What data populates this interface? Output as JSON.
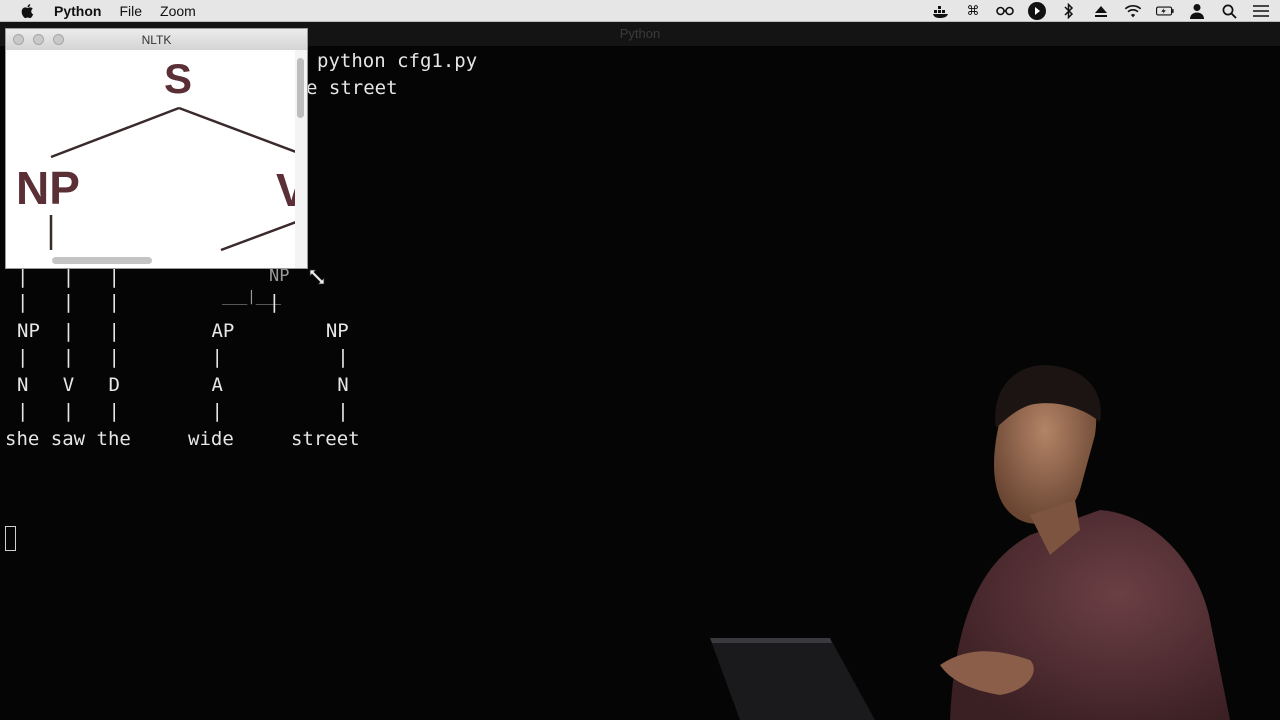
{
  "menubar": {
    "app_name": "Python",
    "menus": [
      "File",
      "Zoom"
    ],
    "status_icons": [
      "docker-icon",
      "command-icon",
      "glasses-icon",
      "play-icon",
      "bluetooth-icon",
      "eject-icon",
      "wifi-icon",
      "battery-icon",
      "user-icon",
      "search-icon",
      "list-icon"
    ]
  },
  "terminal": {
    "window_title": "Python",
    "command": "python cfg1.py",
    "input_fragment": "e street",
    "tree_lines": [
      {
        "text": "NP",
        "dim": true
      },
      {
        "text": "|   |   |             |",
        "dim": false
      },
      {
        "text": "NP  |   |        AP        NP",
        "dim": false
      },
      {
        "text": "|   |   |        |          |",
        "dim": false
      },
      {
        "text": "N   V   D        A          N",
        "dim": false
      },
      {
        "text": "|   |   |        |          |",
        "dim": false
      },
      {
        "text": "she saw the     wide     street",
        "dim": false
      }
    ],
    "top_pipes": "|   |   |",
    "underscore_line": "___|___"
  },
  "nltk_window": {
    "title": "NLTK",
    "nodes": {
      "root": "S",
      "left": "NP",
      "right_partial": "V"
    }
  },
  "colors": {
    "node_color": "#5a2f36",
    "terminal_text": "#e6e6e6",
    "menubar_bg": "#e6e6e6"
  }
}
